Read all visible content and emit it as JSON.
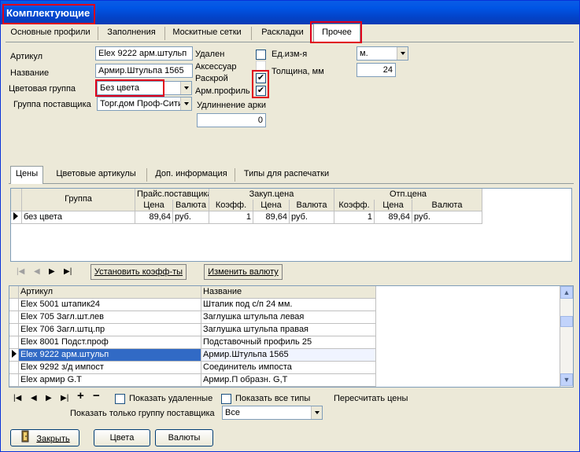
{
  "window": {
    "title": "Комплектующие"
  },
  "main_tabs": [
    {
      "label": "Основные профили"
    },
    {
      "label": "Заполнения"
    },
    {
      "label": "Москитные сетки"
    },
    {
      "label": "Раскладки"
    },
    {
      "label": "Прочее"
    }
  ],
  "form": {
    "article_label": "Артикул",
    "article_value": "Elex 9222 арм.штульп",
    "name_label": "Название",
    "name_value": "Армир.Штульпа 1565",
    "color_group_label": "Цветовая группа",
    "color_group_value": "Без цвета",
    "supplier_group_label": "Группа поставщика",
    "supplier_group_value": "Торг.дом Проф-Сити",
    "deleted_label": "Удален",
    "accessory_label": "Аксессуар",
    "cutting_label": "Раскрой",
    "arm_profile_label": "Арм.профиль",
    "arc_extension_label": "Удлиннение арки",
    "arc_extension_value": "0",
    "unit_label": "Ед.изм-я",
    "unit_value": "м.",
    "thickness_label": "Толщина, мм",
    "thickness_value": "24",
    "checkmark": "✔"
  },
  "sub_tabs": [
    {
      "label": "Цены"
    },
    {
      "label": "Цветовые артикулы"
    },
    {
      "label": "Доп. информация"
    },
    {
      "label": "Типы для распечатки"
    }
  ],
  "price_grid": {
    "group_header": "Группа",
    "supplier_price_header": "Прайс.поставщика",
    "purchase_price_header": "Закуп.цена",
    "sale_price_header": "Отп.цена",
    "sub_headers": [
      "Цена",
      "Валюта",
      "Коэфф.",
      "Цена",
      "Валюта",
      "Коэфф.",
      "Цена",
      "Валюта"
    ],
    "rows": [
      {
        "group": "без цвета",
        "cells": [
          "89,64",
          "руб.",
          "1",
          "89,64",
          "руб.",
          "1",
          "89,64",
          "руб."
        ]
      }
    ]
  },
  "price_toolbar": {
    "set_coeffs_label": "Установить коэфф-ты",
    "change_currency_label": "Изменить валюту"
  },
  "items_grid": {
    "article_header": "Артикул",
    "name_header": "Название",
    "rows": [
      {
        "article": "Elex 5001 штапик24",
        "name": "Штапик под с/п 24 мм.",
        "selected": false
      },
      {
        "article": "Elex 705 Загл.шт.лев",
        "name": "Заглушка штульпа левая",
        "selected": false
      },
      {
        "article": "Elex 706 Загл.штц.пр",
        "name": "Заглушка штульпа правая",
        "selected": false
      },
      {
        "article": "Elex 8001 Подст.проф",
        "name": "Подставочный профиль 25",
        "selected": false
      },
      {
        "article": "Elex 9222 арм.штульп",
        "name": "Армир.Штульпа 1565",
        "selected": true
      },
      {
        "article": "Elex 9292 з/д импост",
        "name": "Соединитель импоста",
        "selected": false
      },
      {
        "article": "Elex армир G.T",
        "name": "Армир.П образн. G,T",
        "selected": false
      }
    ]
  },
  "bottom": {
    "show_deleted_label": "Показать удаленные",
    "show_all_types_label": "Показать все типы",
    "recalc_prices_label": "Пересчитать цены",
    "supplier_filter_label": "Показать только группу поставщика",
    "supplier_filter_value": "Все",
    "close_label": "Закрыть",
    "colors_label": "Цвета",
    "currencies_label": "Валюты"
  },
  "colors": {
    "highlight": "#e0001c",
    "selection": "#316ac5",
    "titlebar": "#0055e5"
  }
}
